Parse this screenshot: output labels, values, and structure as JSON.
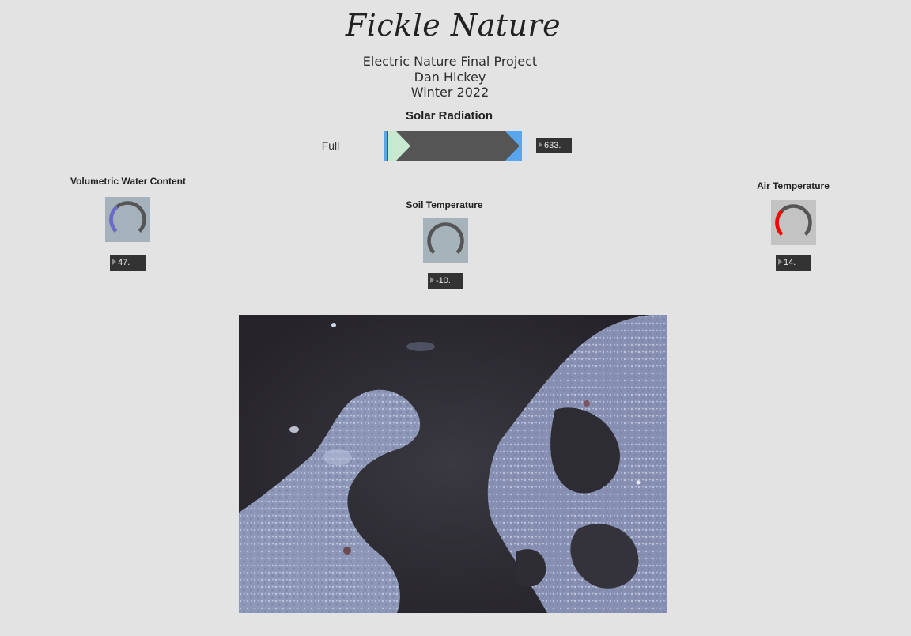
{
  "header": {
    "title": "Fickle Nature",
    "subtitle_lines": [
      "Electric Nature Final Project",
      "Dan Hickey",
      "Winter 2022"
    ]
  },
  "solar": {
    "label": "Solar Radiation",
    "level_label": "Full",
    "value": "633.",
    "slider_level": 1.0
  },
  "sensors": {
    "vwc": {
      "label": "Volumetric Water Content",
      "value": "47.",
      "dial_fraction": 0.35,
      "dial_color": "#6b6bc9"
    },
    "soil": {
      "label": "Soil Temperature",
      "value": "-10.",
      "dial_fraction": 0.0,
      "dial_color": "#555555"
    },
    "air": {
      "label": "Air Temperature",
      "value": "14.",
      "dial_fraction": 0.33,
      "dial_color": "#ff0000"
    }
  },
  "colors": {
    "background": "#e3e3e3",
    "slider_accent": "#58a6ee",
    "slider_body": "#555555",
    "slider_start": "#c8e8cf",
    "numbox_bg": "#333333",
    "dial_track": "#555555"
  },
  "image": {
    "icon": "live-video-frame",
    "subject": "water droplets on dark surface"
  }
}
